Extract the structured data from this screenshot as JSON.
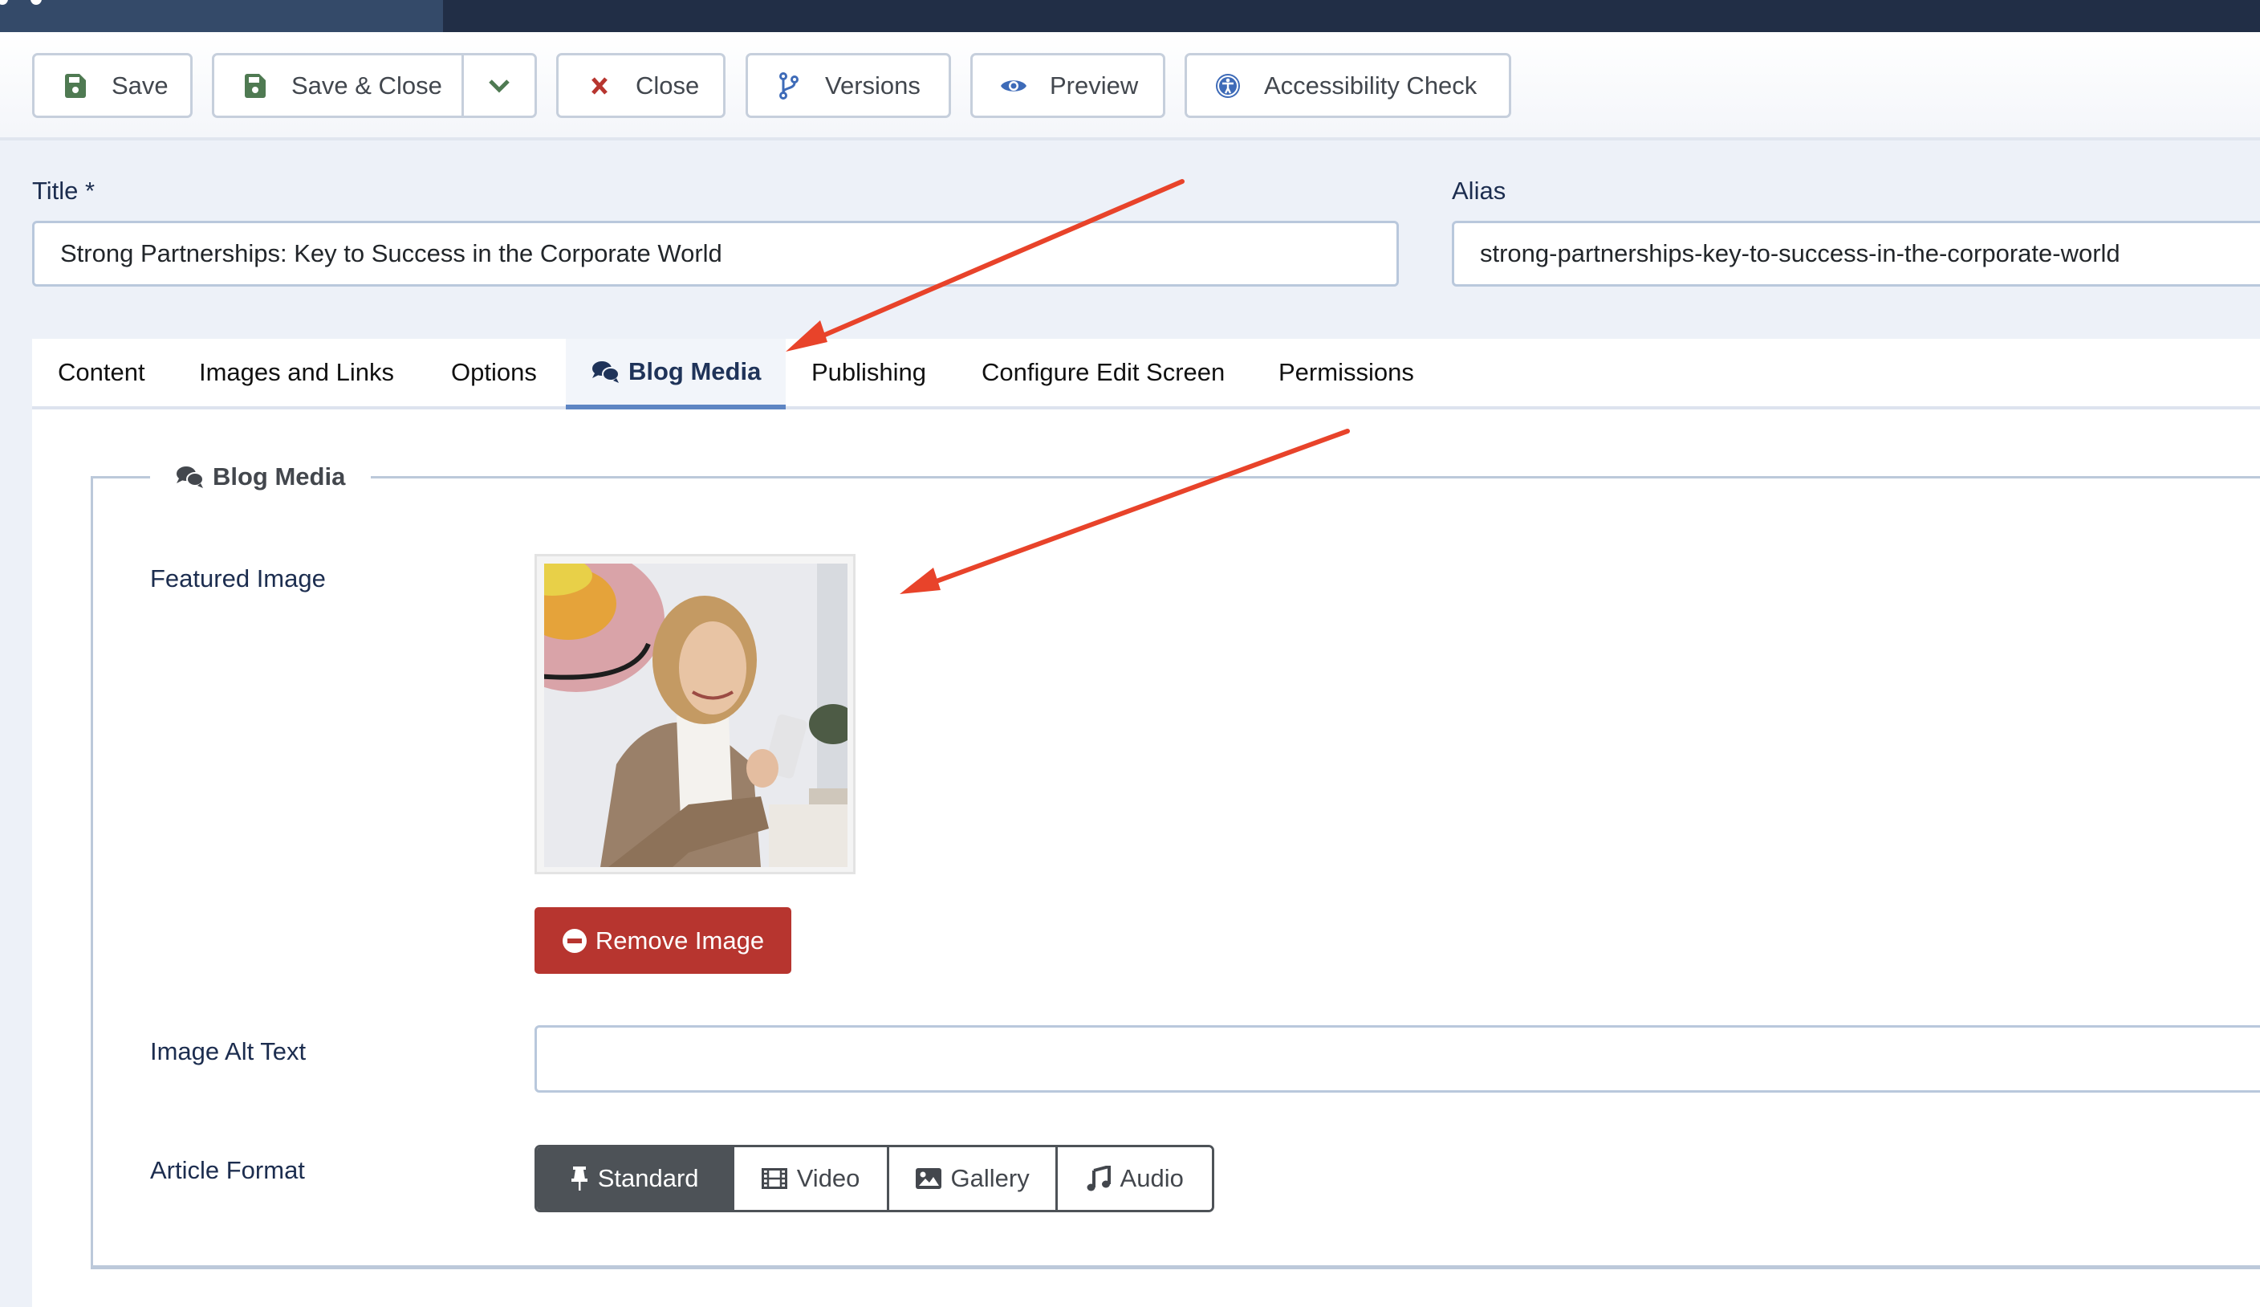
{
  "toolbar": {
    "save": "Save",
    "save_close": "Save & Close",
    "close": "Close",
    "versions": "Versions",
    "preview": "Preview",
    "accessibility_check": "Accessibility Check"
  },
  "form": {
    "title_label": "Title *",
    "title_value": "Strong Partnerships: Key to Success in the Corporate World",
    "alias_label": "Alias",
    "alias_value": "strong-partnerships-key-to-success-in-the-corporate-world"
  },
  "tabs": [
    {
      "label": "Content",
      "active": false
    },
    {
      "label": "Images and Links",
      "active": false
    },
    {
      "label": "Options",
      "active": false
    },
    {
      "label": "Blog Media",
      "active": true
    },
    {
      "label": "Publishing",
      "active": false
    },
    {
      "label": "Configure Edit Screen",
      "active": false
    },
    {
      "label": "Permissions",
      "active": false
    }
  ],
  "blog_media": {
    "legend": "Blog Media",
    "featured_image_label": "Featured Image",
    "featured_image_alt": "Woman in beige blazer smiling at her phone",
    "remove_image_label": "Remove Image",
    "alt_text_label": "Image Alt Text",
    "alt_text_value": "",
    "article_format_label": "Article Format",
    "formats": [
      {
        "label": "Standard",
        "icon": "thumbtack-icon",
        "active": true
      },
      {
        "label": "Video",
        "icon": "film-icon",
        "active": false
      },
      {
        "label": "Gallery",
        "icon": "image-icon",
        "active": false
      },
      {
        "label": "Audio",
        "icon": "music-icon",
        "active": false
      }
    ]
  },
  "colors": {
    "header_left": "#344a69",
    "header_right": "#212e46",
    "save_icon": "#4f7a52",
    "close_icon": "#b7352f",
    "blue_icon": "#3e6bb8",
    "active_tab_underline": "#5e85c3",
    "remove_button": "#b7352f",
    "format_active": "#4d5257",
    "annotation_arrow": "#e8432a"
  },
  "annotations": [
    {
      "type": "arrow",
      "points_to": "Blog Media tab"
    },
    {
      "type": "arrow",
      "points_to": "Featured Image"
    }
  ]
}
